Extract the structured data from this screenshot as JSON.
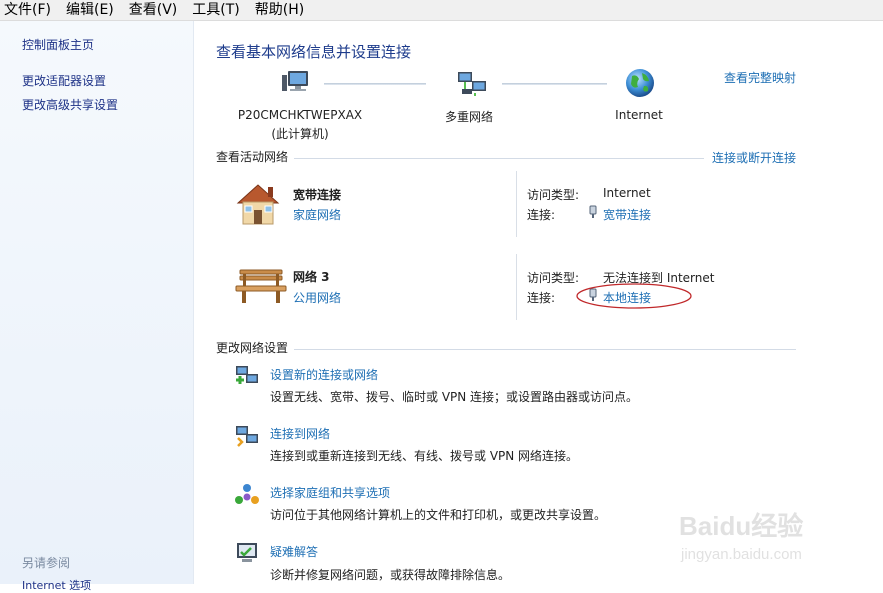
{
  "menubar": {
    "items": [
      "文件(F)",
      "编辑(E)",
      "查看(V)",
      "工具(T)",
      "帮助(H)"
    ]
  },
  "sidebar": {
    "home": "控制面板主页",
    "adapter_settings": "更改适配器设置",
    "advanced_sharing": "更改高级共享设置",
    "see_also": "另请参阅",
    "cutoff_item": "Internet 选项"
  },
  "main": {
    "title": "查看基本网络信息并设置连接",
    "full_map_link": "查看完整映射",
    "map": {
      "computer_name": "P20CMCHKTWEPXAX",
      "computer_sub": "(此计算机)",
      "network": "多重网络",
      "internet": "Internet"
    },
    "active_networks": {
      "header": "查看活动网络",
      "connect_link": "连接或断开连接",
      "networks": [
        {
          "name": "宽带连接",
          "type_link": "家庭网络",
          "access_label": "访问类型:",
          "access_value": "Internet",
          "conn_label": "连接:",
          "conn_value": "宽带连接"
        },
        {
          "name": "网络  3",
          "type_link": "公用网络",
          "access_label": "访问类型:",
          "access_value": "无法连接到 Internet",
          "conn_label": "连接:",
          "conn_value": "本地连接"
        }
      ]
    },
    "change_settings": {
      "header": "更改网络设置",
      "tasks": [
        {
          "link": "设置新的连接或网络",
          "desc": "设置无线、宽带、拨号、临时或 VPN 连接；或设置路由器或访问点。"
        },
        {
          "link": "连接到网络",
          "desc": "连接到或重新连接到无线、有线、拨号或 VPN 网络连接。"
        },
        {
          "link": "选择家庭组和共享选项",
          "desc": "访问位于其他网络计算机上的文件和打印机，或更改共享设置。"
        },
        {
          "link": "疑难解答",
          "desc": "诊断并修复网络问题，或获得故障排除信息。"
        }
      ]
    }
  },
  "watermark": {
    "brand": "Baidu经验",
    "url": "jingyan.baidu.com"
  },
  "colors": {
    "link": "#1e6fb4",
    "title": "#1e3c8c",
    "annotation": "#c0282a"
  }
}
